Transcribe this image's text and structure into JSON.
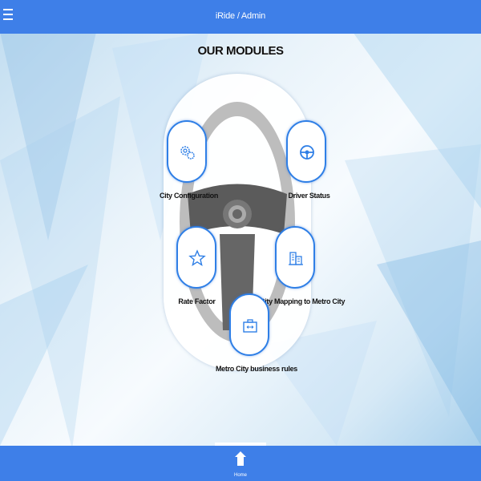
{
  "header": {
    "title": "iRide / Admin",
    "menu_icon": "hamburger-menu-icon"
  },
  "main": {
    "title": "OUR MODULES",
    "modules": [
      {
        "label": "City Configuration",
        "icon": "gears-icon"
      },
      {
        "label": "Driver Status",
        "icon": "steering-wheel-icon"
      },
      {
        "label": "Rate Factor",
        "icon": "star-icon"
      },
      {
        "label": "City Mapping to Metro City",
        "icon": "buildings-icon"
      },
      {
        "label": "Metro City business rules",
        "icon": "briefcase-icon"
      }
    ]
  },
  "footer": {
    "home_label": "Home",
    "home_icon": "home-icon"
  },
  "colors": {
    "primary": "#3e7fe8",
    "module_border": "#2f7fe6",
    "text": "#111111"
  }
}
